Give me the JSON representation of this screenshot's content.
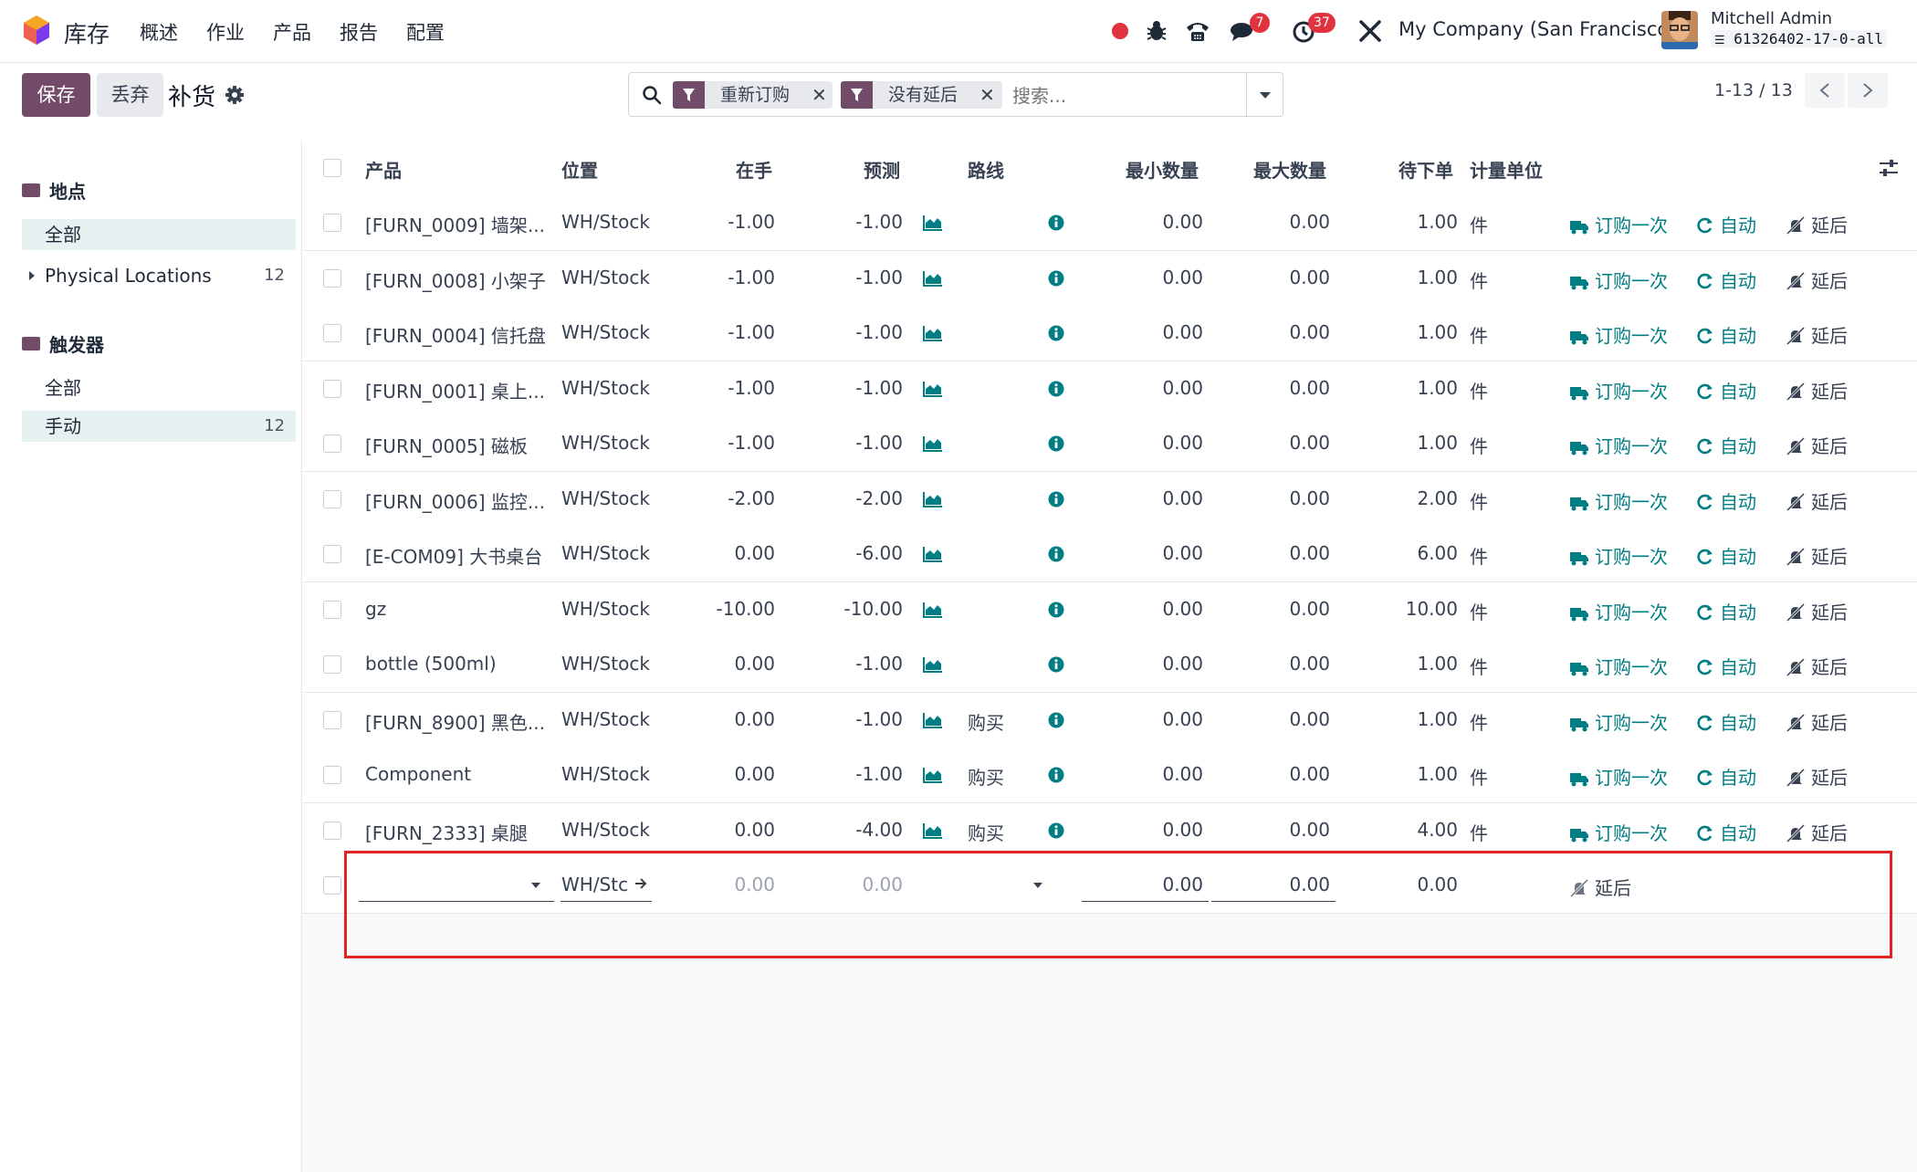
{
  "app": {
    "name": "库存"
  },
  "menu": [
    "概述",
    "作业",
    "产品",
    "报告",
    "配置"
  ],
  "systray": {
    "messages_count": "7",
    "activities_count": "37",
    "company": "My Company (San Francisco)",
    "user_name": "Mitchell Admin",
    "database": "61326402-17-0-all"
  },
  "control": {
    "save_label": "保存",
    "discard_label": "丢弃",
    "title": "补货",
    "filters": [
      "重新订购",
      "没有延后"
    ],
    "search_placeholder": "搜索...",
    "pager": "1-13 / 13"
  },
  "sidebar": {
    "group1": {
      "title": "地点",
      "items": [
        {
          "label": "全部",
          "count": ""
        },
        {
          "label": "Physical Locations",
          "count": "12"
        }
      ]
    },
    "group2": {
      "title": "触发器",
      "items": [
        {
          "label": "全部",
          "count": ""
        },
        {
          "label": "手动",
          "count": "12"
        }
      ]
    }
  },
  "columns": {
    "product": "产品",
    "location": "位置",
    "on_hand": "在手",
    "forecast": "预测",
    "route": "路线",
    "min_qty": "最小数量",
    "max_qty": "最大数量",
    "to_order": "待下单",
    "uom": "计量单位"
  },
  "actions": {
    "order_once": "订购一次",
    "auto": "自动",
    "snooze": "延后"
  },
  "rows": [
    {
      "product": "[FURN_0009] 墙架...",
      "location": "WH/Stock",
      "on_hand": "-1.00",
      "forecast": "-1.00",
      "route": "",
      "min": "0.00",
      "max": "0.00",
      "to_order": "1.00",
      "uom": "件"
    },
    {
      "product": "[FURN_0008] 小架子",
      "location": "WH/Stock",
      "on_hand": "-1.00",
      "forecast": "-1.00",
      "route": "",
      "min": "0.00",
      "max": "0.00",
      "to_order": "1.00",
      "uom": "件"
    },
    {
      "product": "[FURN_0004] 信托盘",
      "location": "WH/Stock",
      "on_hand": "-1.00",
      "forecast": "-1.00",
      "route": "",
      "min": "0.00",
      "max": "0.00",
      "to_order": "1.00",
      "uom": "件"
    },
    {
      "product": "[FURN_0001] 桌上...",
      "location": "WH/Stock",
      "on_hand": "-1.00",
      "forecast": "-1.00",
      "route": "",
      "min": "0.00",
      "max": "0.00",
      "to_order": "1.00",
      "uom": "件"
    },
    {
      "product": "[FURN_0005] 磁板",
      "location": "WH/Stock",
      "on_hand": "-1.00",
      "forecast": "-1.00",
      "route": "",
      "min": "0.00",
      "max": "0.00",
      "to_order": "1.00",
      "uom": "件"
    },
    {
      "product": "[FURN_0006] 监控...",
      "location": "WH/Stock",
      "on_hand": "-2.00",
      "forecast": "-2.00",
      "route": "",
      "min": "0.00",
      "max": "0.00",
      "to_order": "2.00",
      "uom": "件"
    },
    {
      "product": "[E-COM09] 大书桌台",
      "location": "WH/Stock",
      "on_hand": "0.00",
      "forecast": "-6.00",
      "route": "",
      "min": "0.00",
      "max": "0.00",
      "to_order": "6.00",
      "uom": "件"
    },
    {
      "product": "gz",
      "location": "WH/Stock",
      "on_hand": "-10.00",
      "forecast": "-10.00",
      "route": "",
      "min": "0.00",
      "max": "0.00",
      "to_order": "10.00",
      "uom": "件"
    },
    {
      "product": "bottle (500ml)",
      "location": "WH/Stock",
      "on_hand": "0.00",
      "forecast": "-1.00",
      "route": "",
      "min": "0.00",
      "max": "0.00",
      "to_order": "1.00",
      "uom": "件"
    },
    {
      "product": "[FURN_8900] 黑色...",
      "location": "WH/Stock",
      "on_hand": "0.00",
      "forecast": "-1.00",
      "route": "购买",
      "min": "0.00",
      "max": "0.00",
      "to_order": "1.00",
      "uom": "件"
    },
    {
      "product": "Component",
      "location": "WH/Stock",
      "on_hand": "0.00",
      "forecast": "-1.00",
      "route": "购买",
      "min": "0.00",
      "max": "0.00",
      "to_order": "1.00",
      "uom": "件"
    },
    {
      "product": "[FURN_2333] 桌腿",
      "location": "WH/Stock",
      "on_hand": "0.00",
      "forecast": "-4.00",
      "route": "购买",
      "min": "0.00",
      "max": "0.00",
      "to_order": "4.00",
      "uom": "件"
    }
  ],
  "new_row": {
    "location": "WH/Stc",
    "on_hand": "0.00",
    "forecast": "0.00",
    "min": "0.00",
    "max": "0.00",
    "to_order": "0.00",
    "snooze": "延后"
  }
}
